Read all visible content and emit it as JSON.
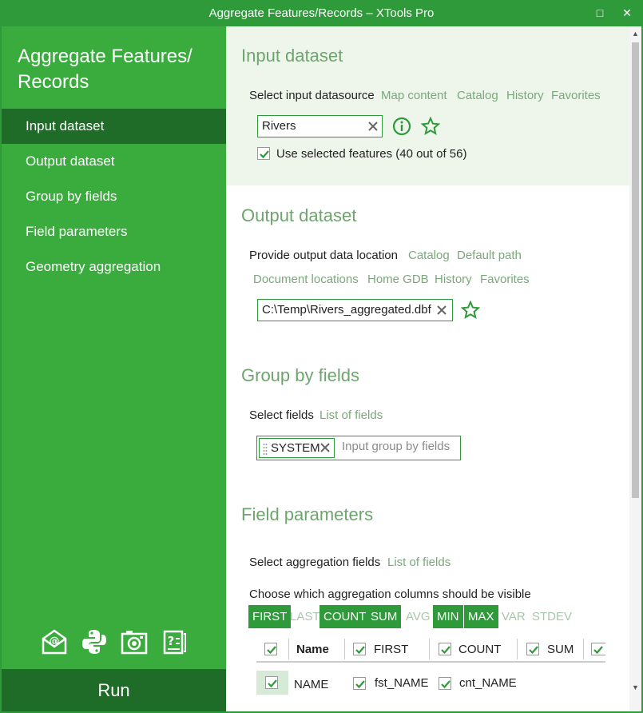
{
  "window": {
    "title": "Aggregate Features/Records – XTools Pro",
    "restore_glyph": "□",
    "close_glyph": "✕"
  },
  "sidebar": {
    "title_line1": "Aggregate Features/",
    "title_line2": "Records",
    "items": [
      {
        "label": "Input dataset",
        "active": true
      },
      {
        "label": "Output dataset",
        "active": false
      },
      {
        "label": "Group by fields",
        "active": false
      },
      {
        "label": "Field parameters",
        "active": false
      },
      {
        "label": "Geometry aggregation",
        "active": false
      }
    ],
    "icons": [
      "email-icon",
      "python-icon",
      "camera-icon",
      "help-icon"
    ],
    "run_label": "Run"
  },
  "input": {
    "title": "Input dataset",
    "select_label": "Select input datasource",
    "links": [
      "Map content",
      "Catalog",
      "History",
      "Favorites"
    ],
    "value": "Rivers",
    "use_selected_label": "Use selected features (40 out of 56)",
    "use_selected_checked": true
  },
  "output": {
    "title": "Output dataset",
    "provide_label": "Provide output data location",
    "links_row1": [
      "Catalog",
      "Default path"
    ],
    "links_row2": [
      "Document locations",
      "Home GDB",
      "History",
      "Favorites"
    ],
    "value": "C:\\Temp\\Rivers_aggregated.dbf"
  },
  "group": {
    "title": "Group by fields",
    "select_label": "Select fields",
    "list_link": "List of fields",
    "tag": "SYSTEM",
    "placeholder": "Input group by fields"
  },
  "params": {
    "title": "Field parameters",
    "select_label": "Select aggregation fields",
    "list_link": "List of fields",
    "columns_label": "Choose which aggregation columns should be visible",
    "toggles": [
      {
        "label": "FIRST",
        "on": true
      },
      {
        "label": "LAST",
        "on": false
      },
      {
        "label": "COUNT",
        "on": true
      },
      {
        "label": "SUM",
        "on": true
      },
      {
        "label": "AVG",
        "on": false
      },
      {
        "label": "MIN",
        "on": true
      },
      {
        "label": "MAX",
        "on": true
      },
      {
        "label": "VAR",
        "on": false
      },
      {
        "label": "STDEV",
        "on": false
      }
    ],
    "grid_headers": [
      "Name",
      "FIRST",
      "COUNT",
      "SUM"
    ],
    "row": {
      "name": "NAME",
      "first": "fst_NAME",
      "count": "cnt_NAME"
    }
  },
  "colors": {
    "accent": "#2e9a39",
    "sidebar": "#3aac3e",
    "sidebar_active": "#1f6b28",
    "link": "#7ba87b",
    "section_title": "#6ea46e"
  }
}
